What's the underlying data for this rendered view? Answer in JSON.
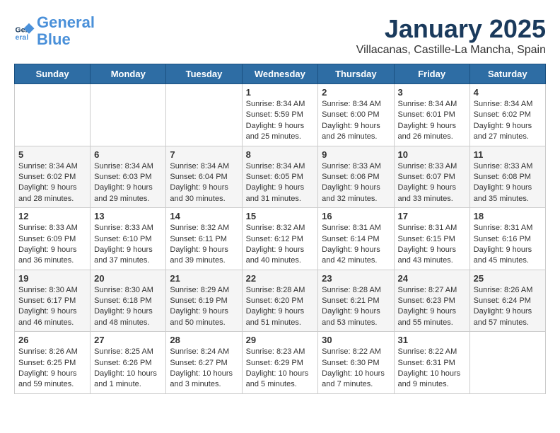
{
  "logo": {
    "text_general": "General",
    "text_blue": "Blue"
  },
  "title": "January 2025",
  "subtitle": "Villacanas, Castille-La Mancha, Spain",
  "weekdays": [
    "Sunday",
    "Monday",
    "Tuesday",
    "Wednesday",
    "Thursday",
    "Friday",
    "Saturday"
  ],
  "weeks": [
    [
      {
        "day": "",
        "info": ""
      },
      {
        "day": "",
        "info": ""
      },
      {
        "day": "",
        "info": ""
      },
      {
        "day": "1",
        "info": "Sunrise: 8:34 AM\nSunset: 5:59 PM\nDaylight: 9 hours\nand 25 minutes."
      },
      {
        "day": "2",
        "info": "Sunrise: 8:34 AM\nSunset: 6:00 PM\nDaylight: 9 hours\nand 26 minutes."
      },
      {
        "day": "3",
        "info": "Sunrise: 8:34 AM\nSunset: 6:01 PM\nDaylight: 9 hours\nand 26 minutes."
      },
      {
        "day": "4",
        "info": "Sunrise: 8:34 AM\nSunset: 6:02 PM\nDaylight: 9 hours\nand 27 minutes."
      }
    ],
    [
      {
        "day": "5",
        "info": "Sunrise: 8:34 AM\nSunset: 6:02 PM\nDaylight: 9 hours\nand 28 minutes."
      },
      {
        "day": "6",
        "info": "Sunrise: 8:34 AM\nSunset: 6:03 PM\nDaylight: 9 hours\nand 29 minutes."
      },
      {
        "day": "7",
        "info": "Sunrise: 8:34 AM\nSunset: 6:04 PM\nDaylight: 9 hours\nand 30 minutes."
      },
      {
        "day": "8",
        "info": "Sunrise: 8:34 AM\nSunset: 6:05 PM\nDaylight: 9 hours\nand 31 minutes."
      },
      {
        "day": "9",
        "info": "Sunrise: 8:33 AM\nSunset: 6:06 PM\nDaylight: 9 hours\nand 32 minutes."
      },
      {
        "day": "10",
        "info": "Sunrise: 8:33 AM\nSunset: 6:07 PM\nDaylight: 9 hours\nand 33 minutes."
      },
      {
        "day": "11",
        "info": "Sunrise: 8:33 AM\nSunset: 6:08 PM\nDaylight: 9 hours\nand 35 minutes."
      }
    ],
    [
      {
        "day": "12",
        "info": "Sunrise: 8:33 AM\nSunset: 6:09 PM\nDaylight: 9 hours\nand 36 minutes."
      },
      {
        "day": "13",
        "info": "Sunrise: 8:33 AM\nSunset: 6:10 PM\nDaylight: 9 hours\nand 37 minutes."
      },
      {
        "day": "14",
        "info": "Sunrise: 8:32 AM\nSunset: 6:11 PM\nDaylight: 9 hours\nand 39 minutes."
      },
      {
        "day": "15",
        "info": "Sunrise: 8:32 AM\nSunset: 6:12 PM\nDaylight: 9 hours\nand 40 minutes."
      },
      {
        "day": "16",
        "info": "Sunrise: 8:31 AM\nSunset: 6:14 PM\nDaylight: 9 hours\nand 42 minutes."
      },
      {
        "day": "17",
        "info": "Sunrise: 8:31 AM\nSunset: 6:15 PM\nDaylight: 9 hours\nand 43 minutes."
      },
      {
        "day": "18",
        "info": "Sunrise: 8:31 AM\nSunset: 6:16 PM\nDaylight: 9 hours\nand 45 minutes."
      }
    ],
    [
      {
        "day": "19",
        "info": "Sunrise: 8:30 AM\nSunset: 6:17 PM\nDaylight: 9 hours\nand 46 minutes."
      },
      {
        "day": "20",
        "info": "Sunrise: 8:30 AM\nSunset: 6:18 PM\nDaylight: 9 hours\nand 48 minutes."
      },
      {
        "day": "21",
        "info": "Sunrise: 8:29 AM\nSunset: 6:19 PM\nDaylight: 9 hours\nand 50 minutes."
      },
      {
        "day": "22",
        "info": "Sunrise: 8:28 AM\nSunset: 6:20 PM\nDaylight: 9 hours\nand 51 minutes."
      },
      {
        "day": "23",
        "info": "Sunrise: 8:28 AM\nSunset: 6:21 PM\nDaylight: 9 hours\nand 53 minutes."
      },
      {
        "day": "24",
        "info": "Sunrise: 8:27 AM\nSunset: 6:23 PM\nDaylight: 9 hours\nand 55 minutes."
      },
      {
        "day": "25",
        "info": "Sunrise: 8:26 AM\nSunset: 6:24 PM\nDaylight: 9 hours\nand 57 minutes."
      }
    ],
    [
      {
        "day": "26",
        "info": "Sunrise: 8:26 AM\nSunset: 6:25 PM\nDaylight: 9 hours\nand 59 minutes."
      },
      {
        "day": "27",
        "info": "Sunrise: 8:25 AM\nSunset: 6:26 PM\nDaylight: 10 hours\nand 1 minute."
      },
      {
        "day": "28",
        "info": "Sunrise: 8:24 AM\nSunset: 6:27 PM\nDaylight: 10 hours\nand 3 minutes."
      },
      {
        "day": "29",
        "info": "Sunrise: 8:23 AM\nSunset: 6:29 PM\nDaylight: 10 hours\nand 5 minutes."
      },
      {
        "day": "30",
        "info": "Sunrise: 8:22 AM\nSunset: 6:30 PM\nDaylight: 10 hours\nand 7 minutes."
      },
      {
        "day": "31",
        "info": "Sunrise: 8:22 AM\nSunset: 6:31 PM\nDaylight: 10 hours\nand 9 minutes."
      },
      {
        "day": "",
        "info": ""
      }
    ]
  ]
}
